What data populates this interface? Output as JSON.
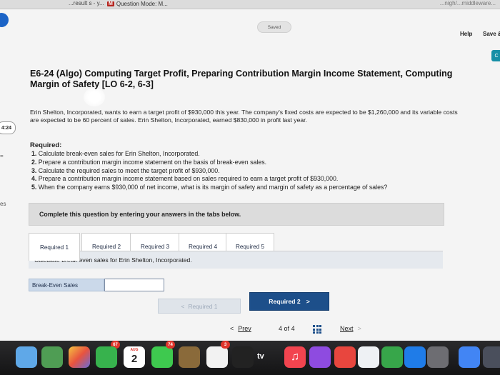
{
  "browser": {
    "left_tab_fragment": "...result s - y...",
    "tab_badge": "M",
    "tab_title": "Question Mode: M...",
    "right_fragment": "...nigh/...middleware..."
  },
  "header": {
    "saved_status": "Saved",
    "help_label": "Help",
    "save_exit_label": "Save &",
    "teal_tag_glyph": "C"
  },
  "sidebar": {
    "timer": "4:24",
    "fragment_mark": "=",
    "fragment_text": "es"
  },
  "question": {
    "title": "E6-24 (Algo) Computing Target Profit, Preparing Contribution Margin Income Statement, Computing Margin of Safety [LO 6-2, 6-3]",
    "intro": "Erin Shelton, Incorporated, wants to earn a target profit of $930,000 this year. The company's fixed costs are expected to be $1,260,000 and its variable costs are expected to be 60 percent of sales. Erin Shelton, Incorporated, earned $830,000 in profit last year.",
    "required_heading": "Required:",
    "required_items": [
      {
        "num": "1.",
        "text": "Calculate break-even sales for Erin Shelton, Incorporated."
      },
      {
        "num": "2.",
        "text": "Prepare a contribution margin income statement on the basis of break-even sales."
      },
      {
        "num": "3.",
        "text": "Calculate the required sales to meet the target profit of $930,000."
      },
      {
        "num": "4.",
        "text": "Prepare a contribution margin income statement based on sales required to earn a target profit of $930,000."
      },
      {
        "num": "5.",
        "text": "When the company earns $930,000 of net income, what is its margin of safety and margin of safety as a percentage of sales?"
      }
    ]
  },
  "instruction": "Complete this question by entering your answers in the tabs below.",
  "tabs": [
    {
      "label": "Required 1",
      "active": true
    },
    {
      "label": "Required 2",
      "active": false
    },
    {
      "label": "Required 3",
      "active": false
    },
    {
      "label": "Required 4",
      "active": false
    },
    {
      "label": "Required 5",
      "active": false
    }
  ],
  "task": {
    "text": "Calculate break-even sales for Erin Shelton, Incorporated.",
    "answer_label": "Break-Even Sales",
    "answer_value": ""
  },
  "nav_buttons": {
    "prev_label": "Required 1",
    "prev_chevron": "<",
    "next_label": "Required 2",
    "next_chevron": ">"
  },
  "pager": {
    "prev_chevron": "<",
    "prev_label": "Prev",
    "current": "4",
    "of_word": "of",
    "total": "4",
    "next_label": "Next",
    "next_chevron": ">"
  },
  "dock": {
    "badge_photos": "67",
    "calendar_month": "AUG",
    "calendar_day": "2",
    "badge_messages": "74",
    "badge_reminders": "3",
    "tv_label": "tv",
    "music_glyph": "♫"
  },
  "colors": {
    "primary_button": "#1d4f8a",
    "disabled_button": "#dfe4ea",
    "label_cell": "#cbd9ea",
    "panel": "#e5e9ee",
    "instruction_bar": "#dcdcdc",
    "dock": "#1e1e20"
  }
}
